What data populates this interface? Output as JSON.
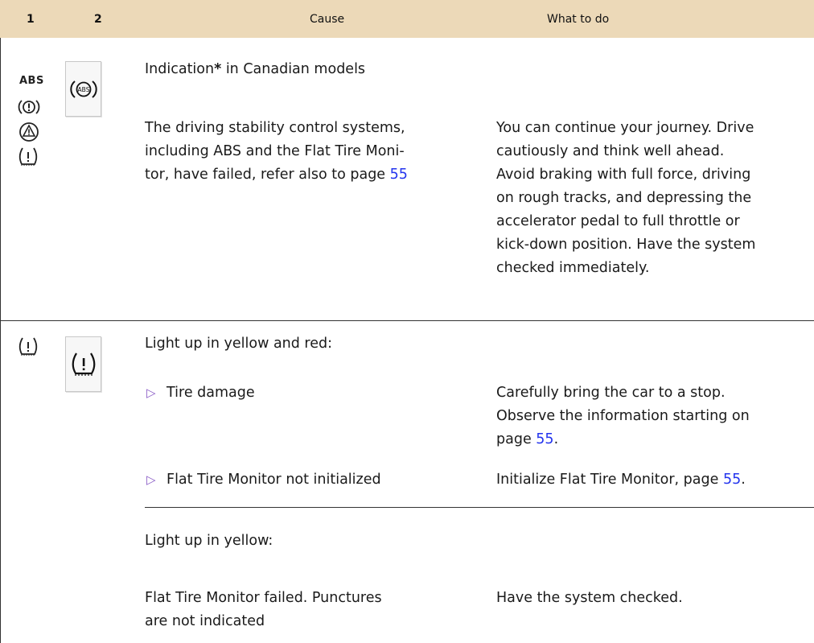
{
  "header": {
    "col1": "1",
    "col2": "2",
    "cause": "Cause",
    "what_to_do": "What to do"
  },
  "row1": {
    "abs_label": "ABS",
    "indication": "Indication",
    "indication_star": "*",
    "indication_rest": " in Canadian models",
    "cause_lines": [
      "The driving stability control systems,",
      "including ABS and the Flat Tire Moni-",
      "tor, have failed, refer also to page "
    ],
    "cause_page": "55",
    "what_lines": [
      "You can continue your journey. Drive",
      "cautiously and think well ahead.",
      "Avoid braking with full force, driving",
      "on rough tracks, and depressing the",
      "accelerator pedal to full throttle or",
      "kick-down position. Have the system",
      "checked immediately."
    ],
    "icons": [
      "abs-icon",
      "brake-warning-icon",
      "stability-triangle-icon",
      "tire-pressure-icon"
    ]
  },
  "row2": {
    "yellow_red_heading": "Light up in yellow and red:",
    "bullet_symbol": "▷",
    "bullet1_cause": "Tire damage",
    "bullet1_what": [
      "Carefully bring the car to a stop.",
      "Observe the information starting on",
      "page "
    ],
    "bullet1_page": "55",
    "bullet1_period": ".",
    "bullet2_cause": "Flat Tire Monitor not initialized",
    "bullet2_what": "Initialize Flat Tire Monitor, page ",
    "bullet2_page": "55",
    "bullet2_period": ".",
    "yellow_heading": "Light up in yellow:",
    "yellow_cause": [
      "Flat Tire Monitor failed. Punctures",
      "are not indicated"
    ],
    "yellow_what": "Have the system checked.",
    "icons": [
      "tire-pressure-icon"
    ]
  },
  "colors": {
    "header_bg": "#ecd9b8",
    "link": "#2233ee",
    "bullet": "#8a5cc6"
  }
}
